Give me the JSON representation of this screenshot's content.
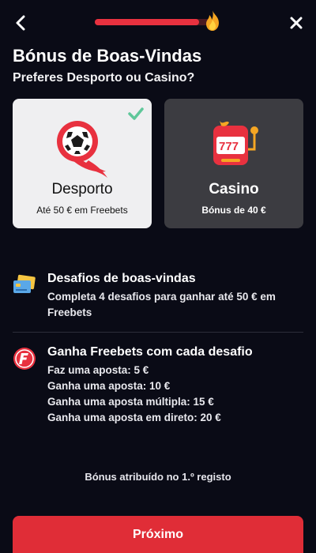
{
  "header": {
    "back_icon": "back-arrow-icon",
    "close_icon": "close-icon",
    "progress": 0.88,
    "progress_icon": "flame-icon"
  },
  "title": "Bónus de Boas-Vindas",
  "subtitle": "Preferes Desporto ou Casino?",
  "options": [
    {
      "title": "Desporto",
      "subtitle": "Até 50 € em Freebets",
      "icon": "soccer-ball-icon",
      "selected": true
    },
    {
      "title": "Casino",
      "subtitle": "Bónus de 40 €",
      "icon": "slot-machine-icon",
      "selected": false
    }
  ],
  "info": [
    {
      "icon": "cards-icon",
      "title": "Desafios de boas-vindas",
      "lines": [
        "Completa 4 desafios para ganhar até 50 € em Freebets"
      ]
    },
    {
      "icon": "freebet-f-icon",
      "title": "Ganha Freebets com cada desafio",
      "lines": [
        "Faz uma aposta: 5 €",
        "Ganha uma aposta: 10 €",
        "Ganha uma aposta múltipla: 15 €",
        "Ganha uma aposta em direto: 20 €"
      ]
    }
  ],
  "footnote": "Bónus atribuído no 1.º registo",
  "cta_label": "Próximo",
  "colors": {
    "background": "#0a0b16",
    "accent": "#e02d37",
    "selected_card": "#efeff1",
    "unselected_card": "#3c3c41",
    "check": "#5fc79a"
  }
}
